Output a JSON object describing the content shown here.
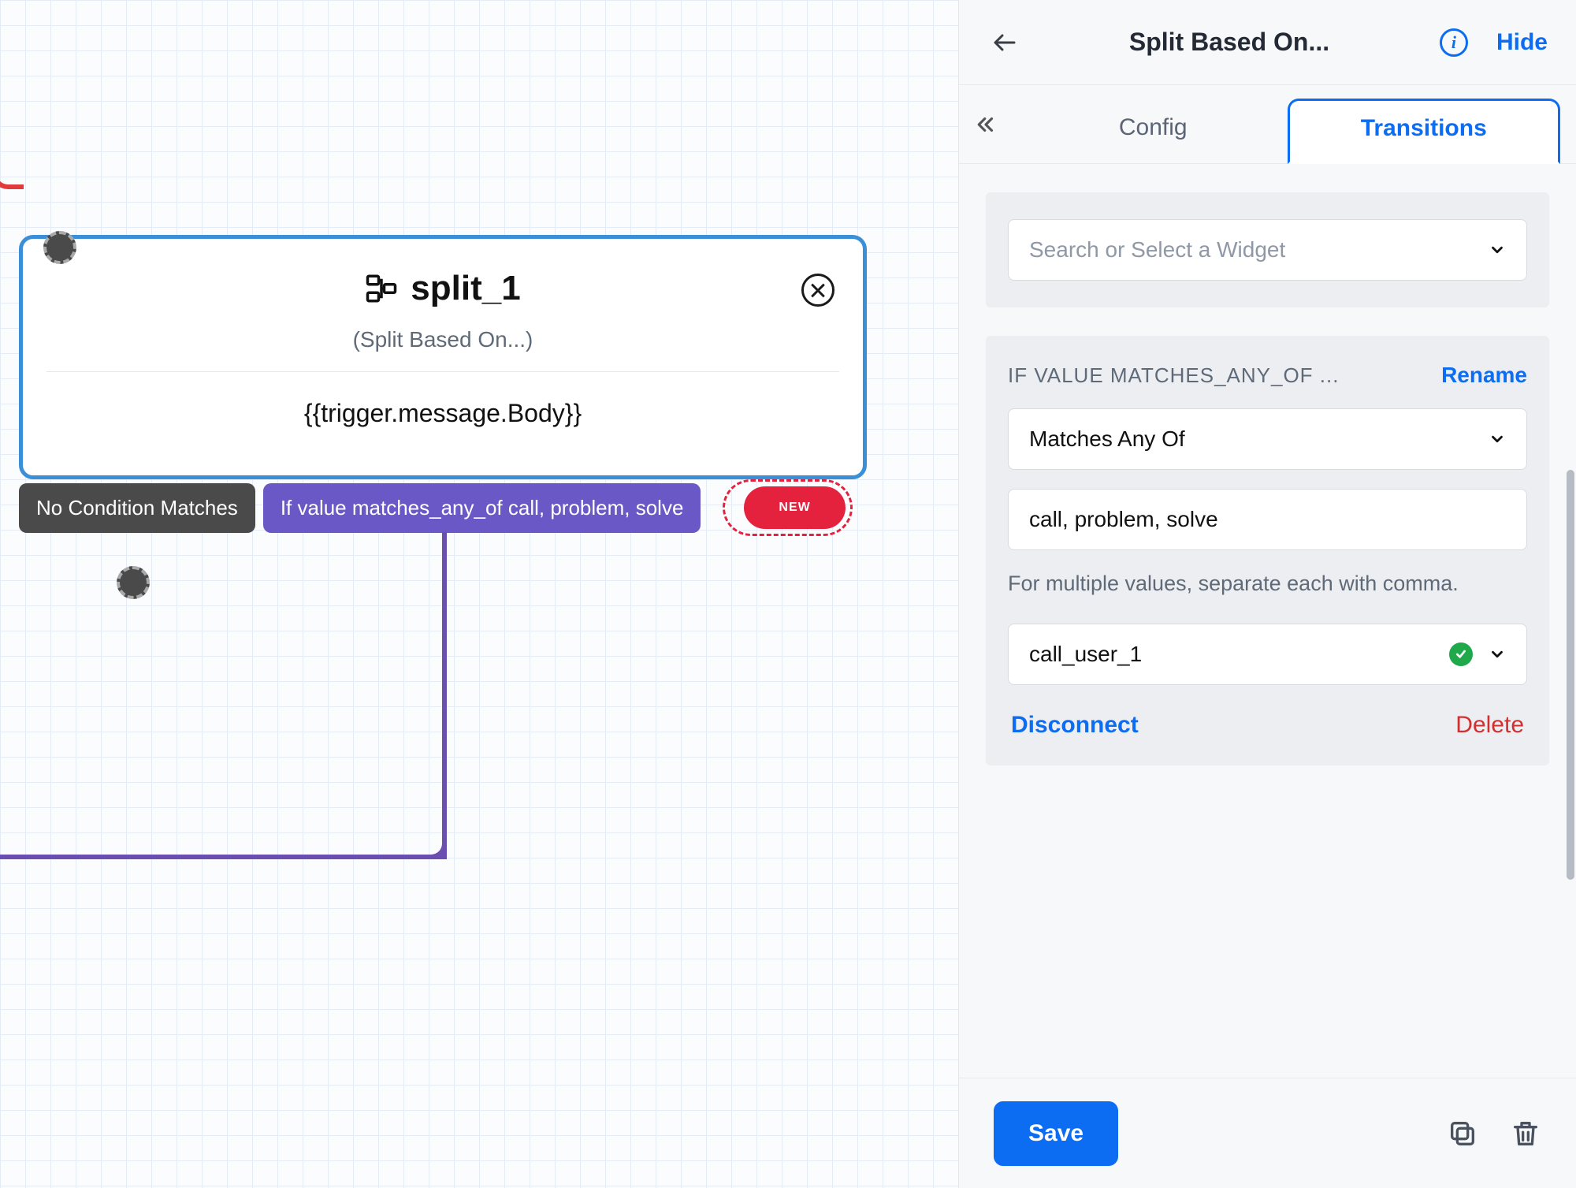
{
  "node": {
    "title": "split_1",
    "subtitle": "(Split Based On...)",
    "expression": "{{trigger.message.Body}}",
    "pills": {
      "no_match": "No Condition Matches",
      "condition": "If value matches_any_of call, problem, solve",
      "new": "NEW"
    }
  },
  "panel": {
    "title": "Split Based On...",
    "hide": "Hide",
    "tabs": {
      "config": "Config",
      "transitions": "Transitions"
    },
    "search_placeholder": "Search or Select a Widget",
    "condition": {
      "header": "IF VALUE MATCHES_ANY_OF ...",
      "rename": "Rename",
      "operator": "Matches Any Of",
      "value": "call, problem, solve",
      "helper": "For multiple values, separate each with comma.",
      "connected": "call_user_1"
    },
    "actions": {
      "disconnect": "Disconnect",
      "delete": "Delete"
    },
    "save": "Save"
  }
}
